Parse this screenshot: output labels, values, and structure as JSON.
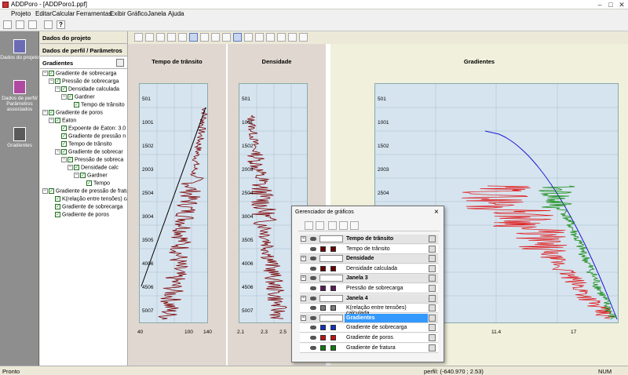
{
  "window": {
    "title": "ADDPoro - [ADDPoro1.ppf]",
    "controls": [
      "–",
      "□",
      "✕"
    ]
  },
  "menu": [
    "Projeto",
    "Editar",
    "Calcular",
    "Ferramentas",
    "Exibir",
    "Gráfico",
    "Janela",
    "Ajuda"
  ],
  "leftnav": [
    {
      "label": "Dados do projeto",
      "icon": "document-icon"
    },
    {
      "label": "Dados de perfil/ Parâmetros associados",
      "icon": "well-log-icon"
    },
    {
      "label": "Gradientes",
      "icon": "gradient-icon"
    }
  ],
  "tree_panel": {
    "header1": "Dados do projeto",
    "header2": "Dados de perfil / Parâmetros a...",
    "header3": "Gradientes",
    "nodes": [
      {
        "label": "Gradiente de sobrecarga",
        "level": 0,
        "expander": "⊟"
      },
      {
        "label": "Pressão de sobrecarga",
        "level": 1,
        "expander": "⊟"
      },
      {
        "label": "Densidade calculada",
        "level": 2,
        "expander": "⊟"
      },
      {
        "label": "Gardner",
        "level": 3,
        "expander": "⊟"
      },
      {
        "label": "Tempo de trânsito",
        "level": 4,
        "expander": ""
      },
      {
        "label": "Gradiente de poros",
        "level": 0,
        "expander": "⊟"
      },
      {
        "label": "Eaton",
        "level": 1,
        "expander": "⊟"
      },
      {
        "label": "Expoente de Eaton: 3.0",
        "level": 2,
        "expander": ""
      },
      {
        "label": "Gradiente de pressão n",
        "level": 2,
        "expander": ""
      },
      {
        "label": "Tempo de trânsito",
        "level": 2,
        "expander": ""
      },
      {
        "label": "Gradiente de sobrecar",
        "level": 2,
        "expander": "⊟"
      },
      {
        "label": "Pressão de sobreca",
        "level": 3,
        "expander": "⊟"
      },
      {
        "label": "Densidade calc",
        "level": 4,
        "expander": "⊟"
      },
      {
        "label": "Gardner",
        "level": 5,
        "expander": "⊟"
      },
      {
        "label": "Tempo",
        "level": 6,
        "expander": ""
      },
      {
        "label": "Gradiente de pressão de fratura",
        "level": 0,
        "expander": "⊟"
      },
      {
        "label": "K(relação entre tensões) calcu",
        "level": 1,
        "expander": ""
      },
      {
        "label": "Gradiente de sobrecarga",
        "level": 1,
        "expander": ""
      },
      {
        "label": "Gradiente de poros",
        "level": 1,
        "expander": ""
      }
    ]
  },
  "charts": {
    "transit": {
      "title": "Tempo de trânsito",
      "depth_labels": [
        "501",
        "1001",
        "1502",
        "2003",
        "2504",
        "3004",
        "3505",
        "4006",
        "4506",
        "5007"
      ],
      "x_ticks": [
        "40",
        "100",
        "140"
      ]
    },
    "density": {
      "title": "Densidade",
      "depth_labels": [
        "501",
        "1001",
        "1502",
        "2003",
        "2504",
        "3004",
        "3505",
        "4006",
        "4506",
        "5007"
      ],
      "x_ticks": [
        "2.1",
        "2.3",
        "2.5"
      ]
    },
    "gradients": {
      "title": "Gradientes",
      "depth_labels": [
        "501",
        "1001",
        "1502",
        "2003",
        "2504"
      ],
      "x_ticks": [
        "11.4",
        "17"
      ]
    }
  },
  "dialog": {
    "title": "Gerenciador de gráficos",
    "close": "×",
    "rows": [
      {
        "label": "Tempo de trânsito",
        "group": true,
        "swatches": []
      },
      {
        "label": "Tempo de trânsito",
        "group": false,
        "swatches": [
          "#6b0000",
          "#6b0000"
        ]
      },
      {
        "label": "Densidade",
        "group": true,
        "swatches": []
      },
      {
        "label": "Densidade calculada",
        "group": false,
        "swatches": [
          "#6b0000",
          "#6b0000"
        ]
      },
      {
        "label": "Janela 3",
        "group": true,
        "swatches": []
      },
      {
        "label": "Pressão de sobrecarga",
        "group": false,
        "swatches": [
          "#5a1a5a",
          "#5a1a5a"
        ]
      },
      {
        "label": "Janela 4",
        "group": true,
        "swatches": []
      },
      {
        "label": "K(relação entre tensões) calculada",
        "group": false,
        "swatches": [
          "#7a7a7a",
          "#7a7a7a"
        ]
      },
      {
        "label": "Gradientes",
        "group": true,
        "selected": true,
        "swatches": []
      },
      {
        "label": "Gradiente de sobrecarga",
        "group": false,
        "swatches": [
          "#1030c0",
          "#1030c0"
        ]
      },
      {
        "label": "Gradiente de poros",
        "group": false,
        "swatches": [
          "#c01010",
          "#c01010"
        ]
      },
      {
        "label": "Gradiente de fratura",
        "group": false,
        "swatches": [
          "#107a10",
          "#107a10"
        ]
      }
    ]
  },
  "status": {
    "left": "Pronto",
    "coords": "perfil: (-640.970 ; 2.53)",
    "num": "NUM"
  },
  "colors": {
    "log_curve": "#7a0000",
    "trend_line": "#000000",
    "overburden": "#1a1ad6",
    "pore": "#e01010",
    "fracture": "#108a10"
  }
}
